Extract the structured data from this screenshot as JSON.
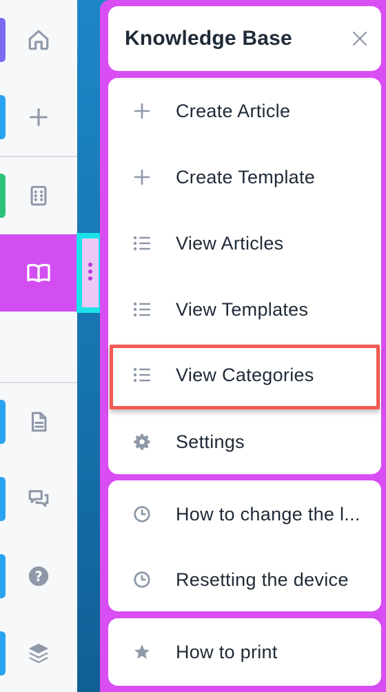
{
  "panel": {
    "title": "Knowledge Base"
  },
  "menu": {
    "items": [
      {
        "label": "Create Article",
        "icon": "plus-icon"
      },
      {
        "label": "Create Template",
        "icon": "plus-icon"
      },
      {
        "label": "View Articles",
        "icon": "list-icon"
      },
      {
        "label": "View Templates",
        "icon": "list-icon"
      },
      {
        "label": "View Categories",
        "icon": "list-icon",
        "highlighted": true
      },
      {
        "label": "Settings",
        "icon": "gear-icon"
      }
    ]
  },
  "recent": {
    "items": [
      {
        "label": "How to change the l...",
        "icon": "clock-icon"
      },
      {
        "label": "Resetting the device",
        "icon": "clock-icon"
      }
    ]
  },
  "favorites": {
    "items": [
      {
        "label": "How to print",
        "icon": "star-icon"
      }
    ]
  },
  "sidebar": {
    "items": [
      {
        "icon": "home-icon",
        "accent": "#7a6cf0"
      },
      {
        "icon": "plus-icon",
        "accent": "#29a3f0"
      },
      {
        "icon": "building-icon",
        "accent": "#2cc27a"
      },
      {
        "icon": "book-icon",
        "active": true
      },
      {
        "icon": "document-icon",
        "accent": "#29a3f0"
      },
      {
        "icon": "chat-icon",
        "accent": "#29a3f0"
      },
      {
        "icon": "help-icon",
        "accent": "#29a3f0"
      },
      {
        "icon": "layers-icon",
        "accent": "#29a3f0"
      }
    ]
  },
  "colors": {
    "panel": "#d84ef2",
    "active": "#d24ef0",
    "highlight": "#f25a52",
    "handle": "#19e3e8",
    "icon": "#8e98a8",
    "text": "#1f2a37"
  }
}
